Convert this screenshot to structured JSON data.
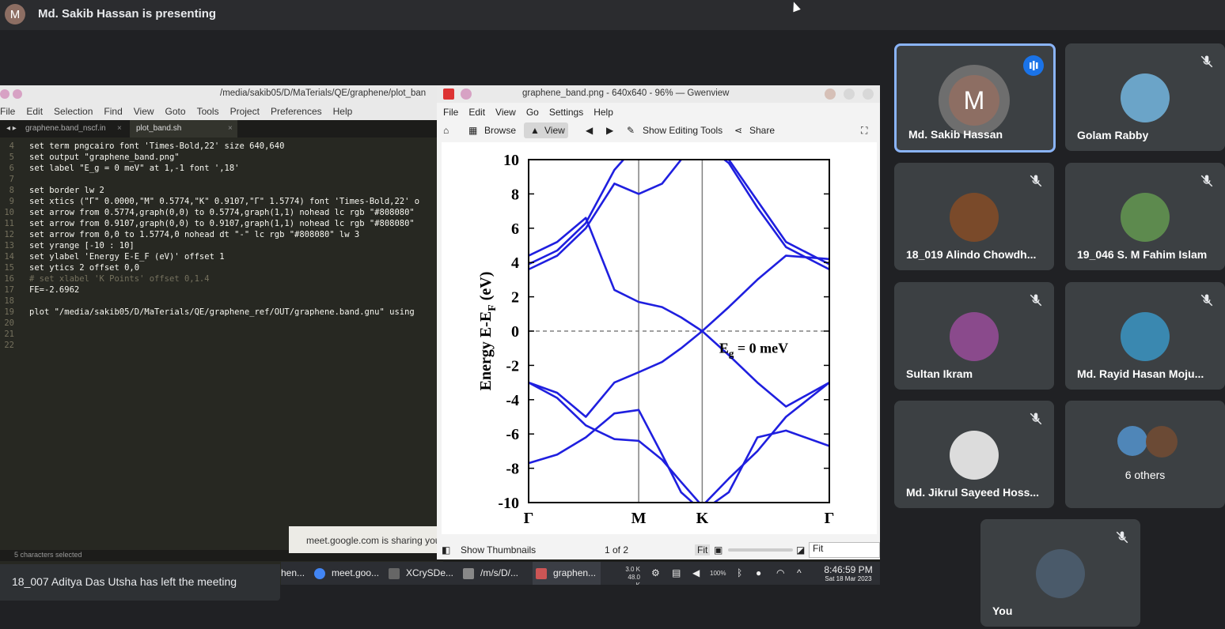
{
  "presenter": {
    "initial": "M",
    "text": "Md. Sakib Hassan is presenting"
  },
  "editor": {
    "title": "/media/sakib05/D/MaTerials/QE/graphene/plot_ban",
    "menu": [
      "File",
      "Edit",
      "Selection",
      "Find",
      "View",
      "Goto",
      "Tools",
      "Project",
      "Preferences",
      "Help"
    ],
    "tabs": [
      "graphene.band_nscf.in",
      "plot_band.sh"
    ],
    "line_numbers": [
      "4",
      "5",
      "6",
      "7",
      "8",
      "9",
      "10",
      "11",
      "12",
      "13",
      "14",
      "15",
      "16",
      "17",
      "18",
      "19",
      "20",
      "21",
      "22"
    ],
    "lines": [
      "set term pngcairo font 'Times-Bold,22' size 640,640",
      "set output \"graphene_band.png\"",
      "set label \"E_g = 0 meV\" at 1,-1 font ',18'",
      "",
      "set border lw 2",
      "set xtics (\"Γ\" 0.0000,\"M\" 0.5774,\"K\" 0.9107,\"Γ\" 1.5774) font 'Times-Bold,22' o",
      "set arrow from 0.5774,graph(0,0) to 0.5774,graph(1,1) nohead lc rgb \"#808080\"",
      "set arrow from 0.9107,graph(0,0) to 0.9107,graph(1,1) nohead lc rgb \"#808080\"",
      "set arrow from 0,0 to 1.5774,0 nohead dt \"-\" lc rgb \"#808080\" lw 3",
      "set yrange [-10 : 10]",
      "set ylabel 'Energy E-E_F (eV)' offset 1",
      "set ytics 2 offset 0,0",
      "# set xlabel 'K Points' offset 0,1.4",
      "FE=-2.6962",
      "",
      "plot \"/media/sakib05/D/MaTerials/QE/graphene_ref/OUT/graphene.band.gnu\" using",
      "",
      "",
      ""
    ],
    "status": "5 characters selected"
  },
  "sharing_banner": "meet.google.com is sharing you",
  "gwenview": {
    "title": "graphene_band.png - 640x640 - 96% — Gwenview",
    "menu": [
      "File",
      "Edit",
      "View",
      "Go",
      "Settings",
      "Help"
    ],
    "toolbar": {
      "browse": "Browse",
      "view": "View",
      "editing": "Show Editing Tools",
      "share": "Share"
    },
    "bottom": {
      "thumbs": "Show Thumbnails",
      "page": "1 of 2",
      "fit": "Fit",
      "zoom_select": "Fit"
    }
  },
  "chart_data": {
    "type": "line",
    "ylabel": "Energy E-E",
    "ylabel_sub": "F",
    "ylabel_unit": " (eV)",
    "ylim": [
      -10,
      10
    ],
    "yticks": [
      "10",
      "8",
      "6",
      "4",
      "2",
      "0",
      "-2",
      "-4",
      "-6",
      "-8",
      "-10"
    ],
    "xticks": [
      {
        "label": "Γ",
        "x": 0.0
      },
      {
        "label": "M",
        "x": 0.5774
      },
      {
        "label": "K",
        "x": 0.9107
      },
      {
        "label": "Γ",
        "x": 1.5774
      }
    ],
    "xlim": [
      0,
      1.5774
    ],
    "annotation": {
      "main": "E",
      "sub": "g",
      "rest": " = 0 meV"
    },
    "color": "#1f1fdf",
    "series": [
      {
        "x": [
          0,
          0.15,
          0.3,
          0.45,
          0.5774,
          0.7,
          0.8,
          0.9107,
          1.05,
          1.2,
          1.35,
          1.5774
        ],
        "y": [
          -3.0,
          -3.9,
          -5.5,
          -6.3,
          -6.4,
          -7.5,
          -8.8,
          -10.2,
          -8.6,
          -7.0,
          -5.0,
          -3.0
        ]
      },
      {
        "x": [
          0,
          0.15,
          0.3,
          0.45,
          0.5774,
          0.7,
          0.8,
          0.9107,
          1.05,
          1.2,
          1.35,
          1.5774
        ],
        "y": [
          -3.0,
          -3.6,
          -5.0,
          -3.0,
          -2.4,
          -1.8,
          -1.0,
          0.0,
          -1.4,
          -3.0,
          -4.4,
          -3.0
        ]
      },
      {
        "x": [
          0,
          0.15,
          0.3,
          0.45,
          0.5774,
          0.7,
          0.8,
          0.9107,
          1.05,
          1.2,
          1.35,
          1.5774
        ],
        "y": [
          -7.7,
          -7.2,
          -6.2,
          -4.8,
          -4.6,
          -7.2,
          -9.4,
          -10.5,
          -9.4,
          -6.2,
          -5.8,
          -6.7
        ]
      },
      {
        "x": [
          0,
          0.15,
          0.3,
          0.45,
          0.5774,
          0.7,
          0.8,
          0.9107,
          1.05,
          1.2,
          1.35,
          1.5774
        ],
        "y": [
          4.4,
          5.2,
          6.6,
          2.4,
          1.7,
          1.4,
          0.8,
          0.0,
          1.4,
          3.0,
          4.4,
          4.2
        ]
      },
      {
        "x": [
          0,
          0.15,
          0.3,
          0.45,
          0.5774,
          0.7,
          0.8,
          0.9107,
          1.05,
          1.2,
          1.35,
          1.5774
        ],
        "y": [
          3.9,
          4.7,
          6.3,
          9.4,
          11.0,
          11.5,
          11.5,
          11.5,
          10.0,
          7.6,
          5.2,
          3.9
        ]
      },
      {
        "x": [
          0,
          0.15,
          0.3,
          0.45,
          0.5774,
          0.7,
          0.8,
          0.9107,
          1.05,
          1.2,
          1.35,
          1.5774
        ],
        "y": [
          3.6,
          4.4,
          6.0,
          8.6,
          8.0,
          8.6,
          10.0,
          11.0,
          9.8,
          7.2,
          4.9,
          3.6
        ]
      }
    ]
  },
  "taskbar": {
    "items": [
      "hen...",
      "meet.goo...",
      "XCrySDe...",
      "/m/s/D/...",
      "graphen..."
    ],
    "net_up": "3.0 K",
    "net_down": "48.0 K",
    "battery": "100%",
    "time": "8:46:59 PM",
    "date": "Sat 18 Mar 2023"
  },
  "notification": "18_007 Aditya Das Utsha has left the meeting",
  "participants": [
    {
      "name": "Md. Sakib Hassan",
      "initial": "M"
    },
    {
      "name": "Golam Rabby"
    },
    {
      "name": "18_019 Alindo Chowdh..."
    },
    {
      "name": "19_046 S. M Fahim Islam"
    },
    {
      "name": "Sultan Ikram"
    },
    {
      "name": "Md. Rayid Hasan Moju..."
    },
    {
      "name": "Md. Jikrul Sayeed Hoss..."
    },
    {
      "name": "6 others"
    },
    {
      "name": "You"
    }
  ]
}
